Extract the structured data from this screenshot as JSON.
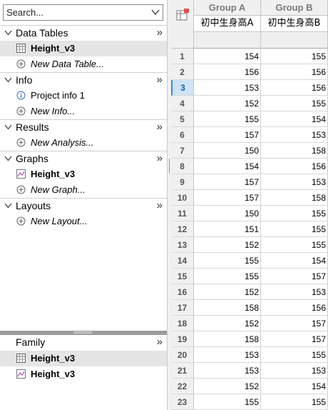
{
  "search": {
    "placeholder": "Search..."
  },
  "sections": [
    {
      "title": "Data Tables",
      "items": [
        {
          "label": "Height_v3",
          "icon": "data-table-icon",
          "style": "bold",
          "selected": true
        },
        {
          "label": "New Data Table...",
          "icon": "add-icon",
          "style": "italic"
        }
      ]
    },
    {
      "title": "Info",
      "items": [
        {
          "label": "Project info 1",
          "icon": "info-icon",
          "style": "normal"
        },
        {
          "label": "New Info...",
          "icon": "add-icon",
          "style": "italic"
        }
      ]
    },
    {
      "title": "Results",
      "items": [
        {
          "label": "New Analysis...",
          "icon": "add-icon",
          "style": "italic"
        }
      ]
    },
    {
      "title": "Graphs",
      "items": [
        {
          "label": "Height_v3",
          "icon": "graph-icon",
          "style": "bold"
        },
        {
          "label": "New Graph...",
          "icon": "add-icon",
          "style": "italic"
        }
      ]
    },
    {
      "title": "Layouts",
      "items": [
        {
          "label": "New Layout...",
          "icon": "add-icon",
          "style": "italic"
        }
      ]
    }
  ],
  "expand_glyph": "»",
  "family": {
    "title": "Family",
    "items": [
      {
        "label": "Height_v3",
        "icon": "data-table-icon",
        "selected": true
      },
      {
        "label": "Height_v3",
        "icon": "graph-icon"
      }
    ]
  },
  "table": {
    "columns": [
      {
        "header": "Group A",
        "title": "初中生身高A"
      },
      {
        "header": "Group B",
        "title": "初中生身高B"
      }
    ],
    "selected_row": 3,
    "rows": [
      {
        "n": "1",
        "a": "154",
        "b": "155"
      },
      {
        "n": "2",
        "a": "156",
        "b": "156"
      },
      {
        "n": "3",
        "a": "153",
        "b": "156"
      },
      {
        "n": "4",
        "a": "152",
        "b": "155"
      },
      {
        "n": "5",
        "a": "155",
        "b": "154"
      },
      {
        "n": "6",
        "a": "157",
        "b": "153"
      },
      {
        "n": "7",
        "a": "150",
        "b": "158"
      },
      {
        "n": "8",
        "a": "154",
        "b": "156"
      },
      {
        "n": "9",
        "a": "157",
        "b": "153"
      },
      {
        "n": "10",
        "a": "157",
        "b": "158"
      },
      {
        "n": "11",
        "a": "150",
        "b": "155"
      },
      {
        "n": "12",
        "a": "151",
        "b": "155"
      },
      {
        "n": "13",
        "a": "152",
        "b": "155"
      },
      {
        "n": "14",
        "a": "155",
        "b": "154"
      },
      {
        "n": "15",
        "a": "155",
        "b": "157"
      },
      {
        "n": "16",
        "a": "152",
        "b": "153"
      },
      {
        "n": "17",
        "a": "158",
        "b": "156"
      },
      {
        "n": "18",
        "a": "152",
        "b": "157"
      },
      {
        "n": "19",
        "a": "158",
        "b": "157"
      },
      {
        "n": "20",
        "a": "153",
        "b": "155"
      },
      {
        "n": "21",
        "a": "153",
        "b": "153"
      },
      {
        "n": "22",
        "a": "152",
        "b": "154"
      },
      {
        "n": "23",
        "a": "155",
        "b": "155"
      }
    ]
  },
  "colors": {
    "selection": "#3b8ad9",
    "selected_item_bg": "#e5e5e5"
  }
}
